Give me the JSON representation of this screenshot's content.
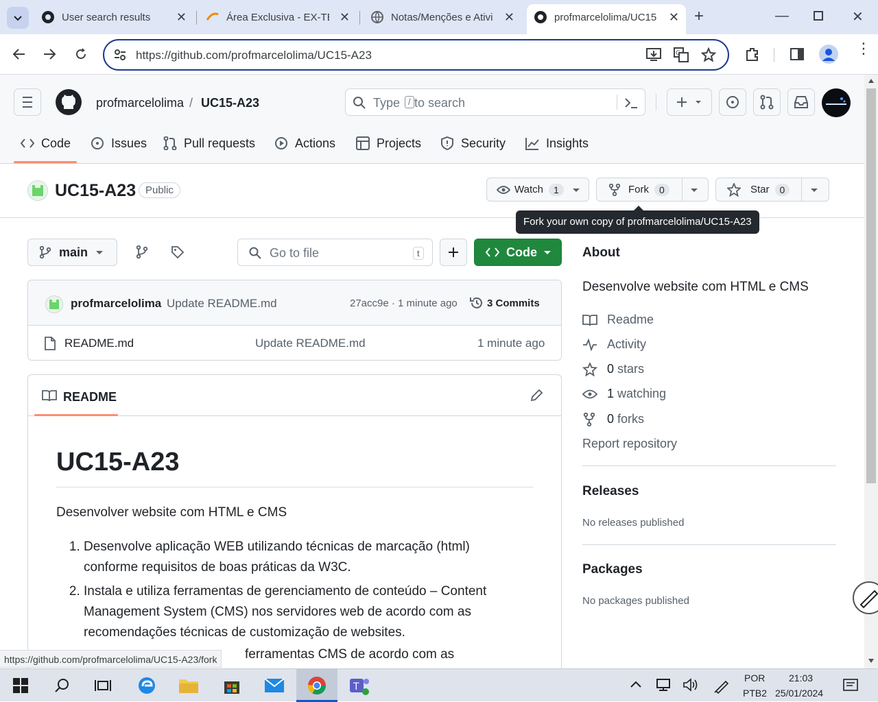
{
  "browser": {
    "tabs": [
      {
        "title": "User search results"
      },
      {
        "title": "Área Exclusiva - EX-TÉC"
      },
      {
        "title": "Notas/Menções e Ativi"
      },
      {
        "title": "profmarcelolima/UC15"
      }
    ],
    "url": "https://github.com/profmarcelolima/UC15-A23",
    "status_url": "https://github.com/profmarcelolima/UC15-A23/fork"
  },
  "header": {
    "owner": "profmarcelolima",
    "sep": "/",
    "repo": "UC15-A23",
    "search_pre": "Type",
    "search_key": "/",
    "search_post": "to search"
  },
  "nav": [
    "Code",
    "Issues",
    "Pull requests",
    "Actions",
    "Projects",
    "Security",
    "Insights"
  ],
  "repo": {
    "name": "UC15-A23",
    "visibility": "Public",
    "watch_label": "Watch",
    "watch_count": "1",
    "fork_label": "Fork",
    "fork_count": "0",
    "star_label": "Star",
    "star_count": "0",
    "tooltip": "Fork your own copy of profmarcelolima/UC15-A23"
  },
  "files": {
    "branch": "main",
    "goto_placeholder": "Go to file",
    "goto_key": "t",
    "code_label": "Code",
    "commit_author": "profmarcelolima",
    "commit_msg": "Update README.md",
    "commit_meta": "27acc9e · 1 minute ago",
    "commits_label": "3 Commits",
    "rows": [
      {
        "name": "README.md",
        "msg": "Update README.md",
        "time": "1 minute ago"
      }
    ]
  },
  "readme": {
    "tab": "README",
    "h1": "UC15-A23",
    "intro": "Desenvolver website com HTML e CMS",
    "items": [
      "Desenvolve aplicação WEB utilizando técnicas de marcação (html) conforme requisitos de boas práticas da W3C.",
      "Instala e utiliza ferramentas de gerenciamento de conteúdo – Content Management System (CMS) nos servidores web de acordo com as recomendações técnicas de customização de websites."
    ],
    "partial": "ferramentas CMS de acordo com as"
  },
  "about": {
    "title": "About",
    "desc": "Desenvolve website com HTML e CMS",
    "readme": "Readme",
    "activity": "Activity",
    "stars_n": "0",
    "stars": "stars",
    "watching_n": "1",
    "watching": "watching",
    "forks_n": "0",
    "forks": "forks",
    "report": "Report repository",
    "releases_title": "Releases",
    "releases_empty": "No releases published",
    "packages_title": "Packages",
    "packages_empty": "No packages published"
  },
  "taskbar": {
    "lang1": "POR",
    "lang2": "PTB2",
    "time": "21:03",
    "date": "25/01/2024"
  }
}
